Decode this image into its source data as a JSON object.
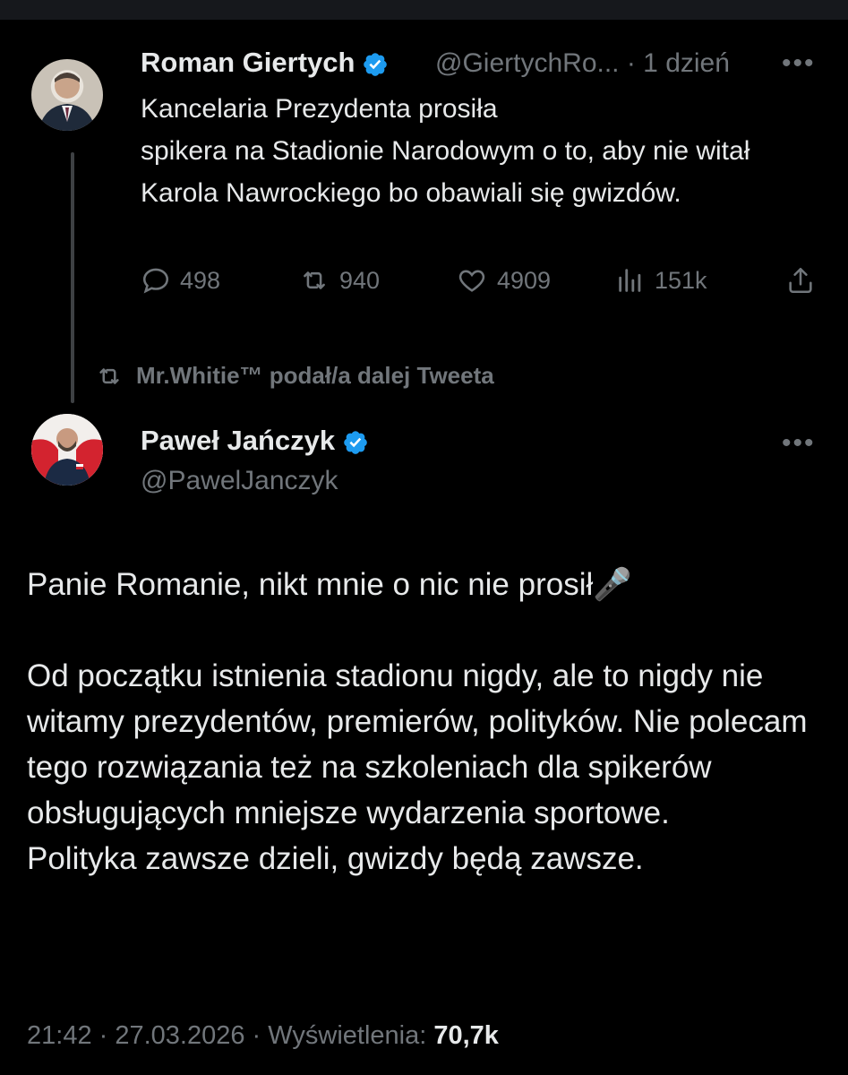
{
  "tweet1": {
    "author_name": "Roman Giertych",
    "handle": "@GiertychRo...",
    "time": "· 1 dzień",
    "text": "Kancelaria Prezydenta prosiła\nspikera na Stadionie Narodowym o to, aby nie witał Karola Nawrockiego bo obawiali się gwizdów.",
    "replies": "498",
    "retweets": "940",
    "likes": "4909",
    "views": "151k"
  },
  "retweet_note": "Mr.Whitie™ podał/a dalej Tweeta",
  "tweet2": {
    "author_name": "Paweł Jańczyk",
    "handle": "@PawelJanczyk",
    "text": "Panie Romanie, nikt mnie o nic nie prosił🎤\n\nOd początku istnienia stadionu nigdy, ale to nigdy nie witamy prezydentów, premierów, polityków. Nie polecam tego rozwiązania też na szkoleniach dla spikerów obsługujących mniejsze wydarzenia sportowe.\nPolityka zawsze dzieli, gwizdy będą zawsze.",
    "timestamp": "21:42 · 27.03.2026 · Wyświetlenia: ",
    "views": "70,7k"
  },
  "more_label": "•••",
  "colors": {
    "background": "#000000",
    "text": "#e7e9ea",
    "muted": "#71767b",
    "verified": "#1d9bf0"
  },
  "icons": [
    "reply-icon",
    "retweet-icon",
    "like-icon",
    "views-icon",
    "share-icon",
    "verified-badge-icon",
    "more-icon"
  ]
}
